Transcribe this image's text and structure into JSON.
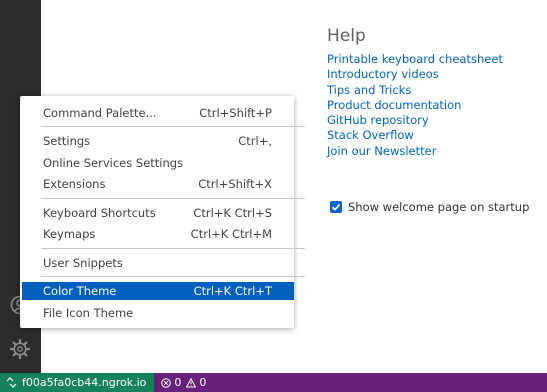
{
  "help": {
    "title": "Help",
    "links": [
      "Printable keyboard cheatsheet",
      "Introductory videos",
      "Tips and Tricks",
      "Product documentation",
      "GitHub repository",
      "Stack Overflow",
      "Join our Newsletter"
    ]
  },
  "startup": {
    "label": "Show welcome page on startup",
    "checked": true
  },
  "menu": {
    "items": [
      {
        "label": "Command Palette...",
        "shortcut": "Ctrl+Shift+P"
      },
      {
        "label": "Settings",
        "shortcut": "Ctrl+,"
      },
      {
        "label": "Online Services Settings",
        "shortcut": ""
      },
      {
        "label": "Extensions",
        "shortcut": "Ctrl+Shift+X"
      },
      {
        "label": "Keyboard Shortcuts",
        "shortcut": "Ctrl+K Ctrl+S"
      },
      {
        "label": "Keymaps",
        "shortcut": "Ctrl+K Ctrl+M"
      },
      {
        "label": "User Snippets",
        "shortcut": ""
      },
      {
        "label": "Color Theme",
        "shortcut": "Ctrl+K Ctrl+T",
        "selected": true
      },
      {
        "label": "File Icon Theme",
        "shortcut": ""
      }
    ]
  },
  "status": {
    "remote": "f00a5fa0cb44.ngrok.io",
    "errors": "0",
    "warnings": "0"
  },
  "colors": {
    "activity_bar": "#2c2c2c",
    "status_bar": "#68217a",
    "remote_badge": "#16825d",
    "menu_selection": "#0060c0",
    "link": "#0066bf"
  }
}
